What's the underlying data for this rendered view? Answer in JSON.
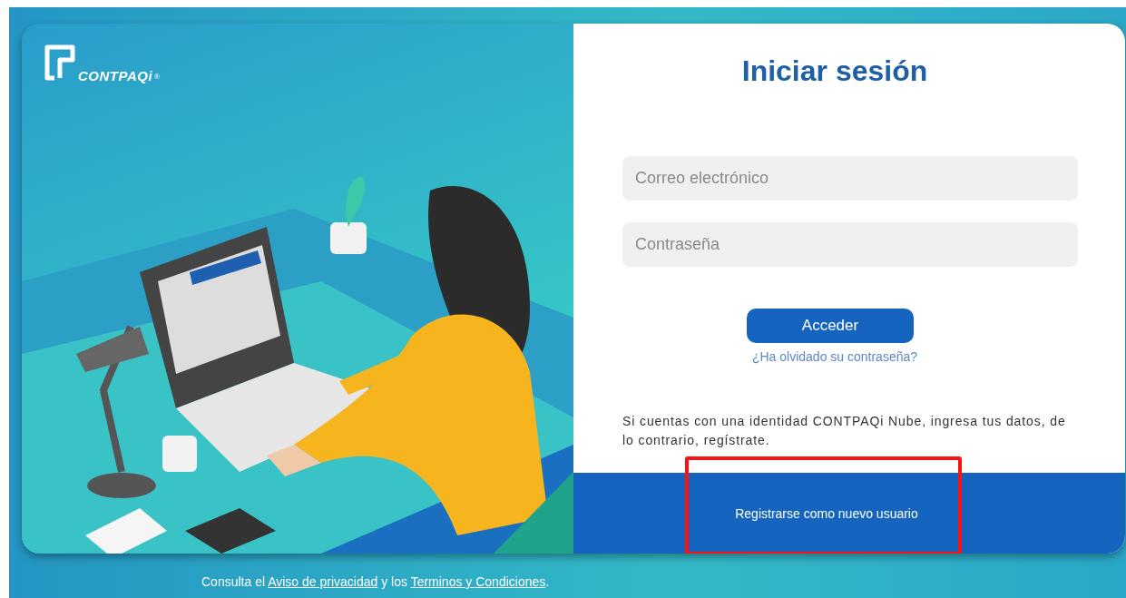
{
  "brand": {
    "name": "CONTPAQi",
    "mark": "®"
  },
  "login": {
    "title": "Iniciar sesión",
    "fields": [
      {
        "placeholder": "Correo electrónico"
      },
      {
        "placeholder": "Contraseña"
      }
    ],
    "submit": "Acceder",
    "forgot_link": "¿Ha olvidado su contraseña?",
    "info": "Si cuentas con una identidad CONTPAQi Nube, ingresa tus datos, de lo contrario, regístrate.",
    "register": {
      "label": "Registrarse como nuevo usuario",
      "highlighted": true
    }
  },
  "footer": [
    {
      "kind": "text",
      "text": "Consulta el "
    },
    {
      "kind": "link",
      "text": "Aviso de privacidad"
    },
    {
      "kind": "text",
      "text": " y los "
    },
    {
      "kind": "link",
      "text": "Terminos y Condiciones"
    },
    {
      "kind": "text",
      "text": "."
    }
  ]
}
